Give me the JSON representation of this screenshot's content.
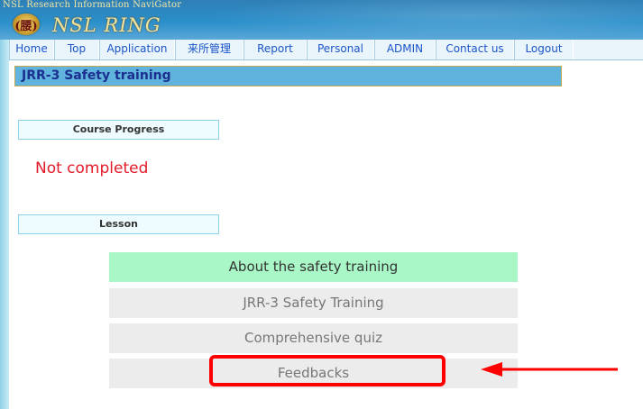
{
  "banner": {
    "caption": "NSL Research Information NaviGator",
    "logo_glyph": "(腰)",
    "title": "NSL RING"
  },
  "nav": {
    "items": [
      {
        "label": "Home"
      },
      {
        "label": "Top"
      },
      {
        "label": "Application"
      },
      {
        "label": "来所管理"
      },
      {
        "label": "Report"
      },
      {
        "label": "Personal"
      },
      {
        "label": "ADMIN"
      },
      {
        "label": "Contact us"
      },
      {
        "label": "Logout"
      }
    ]
  },
  "page": {
    "title": "JRR-3 Safety training",
    "progress_label": "Course Progress",
    "progress_status": "Not completed",
    "lesson_label": "Lesson",
    "lessons": [
      {
        "label": "About the safety training",
        "active": true
      },
      {
        "label": "JRR-3 Safety Training",
        "active": false
      },
      {
        "label": "Comprehensive quiz",
        "active": false
      },
      {
        "label": "Feedbacks",
        "active": false
      }
    ]
  },
  "annotation": {
    "highlight_color": "#ff0000",
    "arrow_color": "#ff0000"
  },
  "colors": {
    "nav_text": "#1b55c9",
    "header_bg": "#5fb3dc",
    "status_red": "#e21b2a",
    "active_lesson_bg": "#a9f7c6"
  }
}
